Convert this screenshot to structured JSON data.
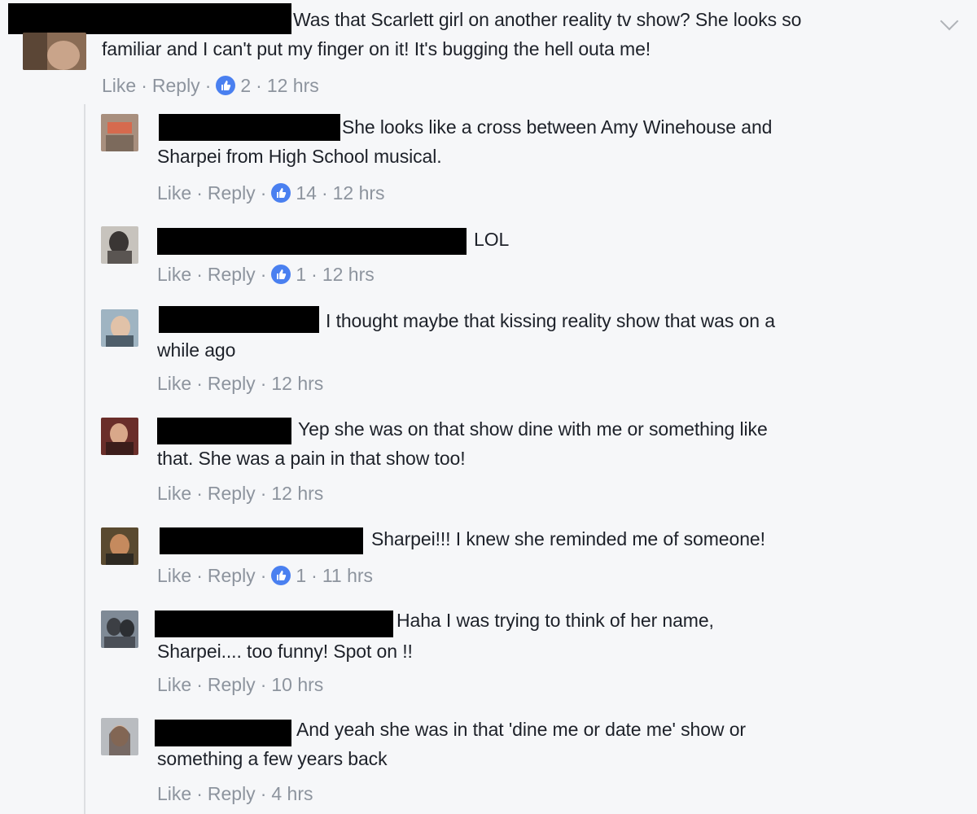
{
  "actions": {
    "like": "Like",
    "reply": "Reply"
  },
  "colors": {
    "accent": "#4a80f0",
    "background": "#f6f7f9",
    "meta": "#8d949e",
    "redaction": "#000000"
  },
  "icons": {
    "reaction": "thumbs-up-icon",
    "menu": "chevron-down-icon"
  },
  "top_comment": {
    "line1": "Was that Scarlett girl on another reality tv show? She looks so",
    "line2": "familiar and I can't put my finger on it! It's bugging the hell outa me!",
    "reactions": "2",
    "time": "12 hrs"
  },
  "replies": [
    {
      "line1": "She looks like a cross between Amy Winehouse and",
      "line2": "Sharpei from High School musical.",
      "reactions": "14",
      "time": "12 hrs"
    },
    {
      "line1": "LOL",
      "line2": "",
      "reactions": "1",
      "time": "12 hrs"
    },
    {
      "line1": "I thought maybe that kissing reality show that was on a",
      "line2": "while ago",
      "reactions": "",
      "time": "12 hrs"
    },
    {
      "line1": "Yep she was on that show dine with me or something like",
      "line2": "that. She was a pain in that show too!",
      "reactions": "",
      "time": "12 hrs"
    },
    {
      "line1": "Sharpei!!! I knew she reminded me of someone!",
      "line2": "",
      "reactions": "1",
      "time": "11 hrs"
    },
    {
      "line1": "Haha I was trying to think of her name,",
      "line2": "Sharpei.... too funny! Spot on !!",
      "reactions": "",
      "time": "10 hrs"
    },
    {
      "line1": "And yeah she was in that 'dine me or date me' show or",
      "line2": "something a few years back",
      "reactions": "",
      "time": "4 hrs"
    }
  ]
}
